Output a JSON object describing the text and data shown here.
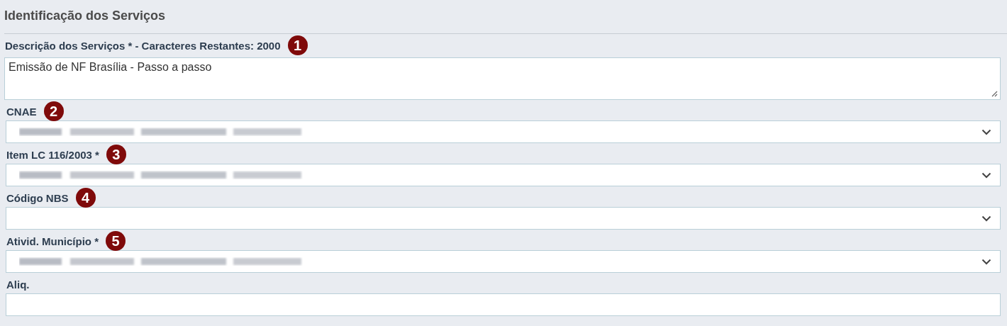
{
  "section": {
    "title": "Identificação dos Serviços"
  },
  "fields": [
    {
      "kind": "textarea",
      "label": "Descrição dos Serviços * - Caracteres Restantes: 2000",
      "marker": "1",
      "value": "Emissão de NF Brasília - Passo a passo"
    },
    {
      "kind": "select",
      "label": "CNAE",
      "marker": "2",
      "redacted": true
    },
    {
      "kind": "select",
      "label": "Item LC 116/2003 *",
      "marker": "3",
      "redacted": true
    },
    {
      "kind": "select",
      "label": "Código NBS",
      "marker": "4"
    },
    {
      "kind": "select",
      "label": "Ativid. Município *",
      "marker": "5",
      "redacted": true
    },
    {
      "kind": "text",
      "label": "Aliq."
    }
  ]
}
